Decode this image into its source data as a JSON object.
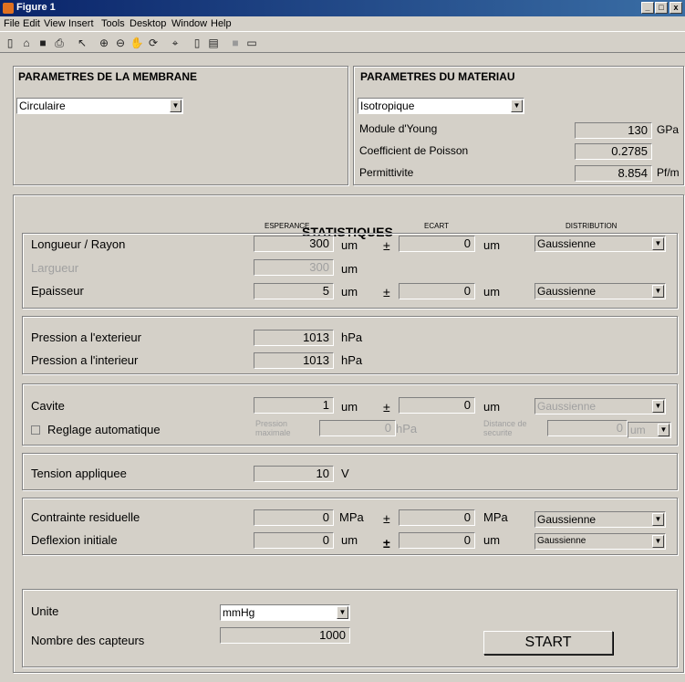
{
  "window": {
    "title": "Figure 1",
    "controls": [
      "_",
      "□",
      "x"
    ]
  },
  "menu": [
    "File",
    "Edit",
    "View",
    "Insert",
    "Tools",
    "Desktop",
    "Window",
    "Help"
  ],
  "toolbar": [
    "new-file",
    "open",
    "save",
    "print",
    "pointer",
    "zoom-in",
    "zoom-out",
    "pan",
    "rotate",
    "data-cursor",
    "colorbar",
    "legend",
    "hide-plot",
    "show-plot"
  ],
  "membrane": {
    "title": "PARAMETRES DE LA MEMBRANE",
    "shape": "Circulaire"
  },
  "materiau": {
    "title": "PARAMETRES DU MATERIAU",
    "type": "Isotropique",
    "young_label": "Module d'Young",
    "young_value": "130",
    "young_unit": "GPa",
    "poisson_label": "Coefficient de Poisson",
    "poisson_value": "0.2785",
    "perm_label": "Permittivite",
    "perm_value": "8.854",
    "perm_unit": "Pf/m"
  },
  "stats": {
    "title": "STATISTIQUES",
    "col_esperance": "ESPERANCE",
    "col_ecart": "ECART",
    "col_distribution": "DISTRIBUTION",
    "longueur": {
      "label": "Longueur / Rayon",
      "value": "300",
      "unit": "um",
      "pm": "±",
      "ecart": "0",
      "ecart_unit": "um",
      "dist": "Gaussienne"
    },
    "largeur": {
      "label": "Largueur",
      "value": "300",
      "unit": "um"
    },
    "epaisseur": {
      "label": "Epaisseur",
      "value": "5",
      "unit": "um",
      "pm": "±",
      "ecart": "0",
      "ecart_unit": "um",
      "dist": "Gaussienne"
    },
    "pext": {
      "label": "Pression a l'exterieur",
      "value": "1013",
      "unit": "hPa"
    },
    "pint": {
      "label": "Pression a l'interieur",
      "value": "1013",
      "unit": "hPa"
    },
    "cavite": {
      "label": "Cavite",
      "value": "1",
      "unit": "um",
      "pm": "±",
      "ecart": "0",
      "ecart_unit": "um",
      "dist": "Gaussienne"
    },
    "reglage": {
      "label": "Reglage automatique",
      "pmax_label1": "Pression",
      "pmax_label2": "maximale",
      "pmax_value": "0",
      "pmax_unit": "hPa",
      "dist_label1": "Distance de",
      "dist_label2": "securite",
      "dist_value": "0",
      "dist_unit": "um"
    },
    "tension": {
      "label": "Tension appliquee",
      "value": "10",
      "unit": "V"
    },
    "contrainte": {
      "label": "Contrainte residuelle",
      "value": "0",
      "unit": "MPa",
      "pm": "±",
      "ecart": "0",
      "ecart_unit": "MPa",
      "dist": "Gaussienne"
    },
    "deflexion": {
      "label": "Deflexion initiale",
      "value": "0",
      "unit": "um",
      "pm": "±",
      "ecart": "0",
      "ecart_unit": "um",
      "dist": "Gaussienne"
    }
  },
  "bottom": {
    "unite_label": "Unite",
    "unite_value": "mmHg",
    "capteurs_label": "Nombre des capteurs",
    "capteurs_value": "1000",
    "start": "START"
  }
}
